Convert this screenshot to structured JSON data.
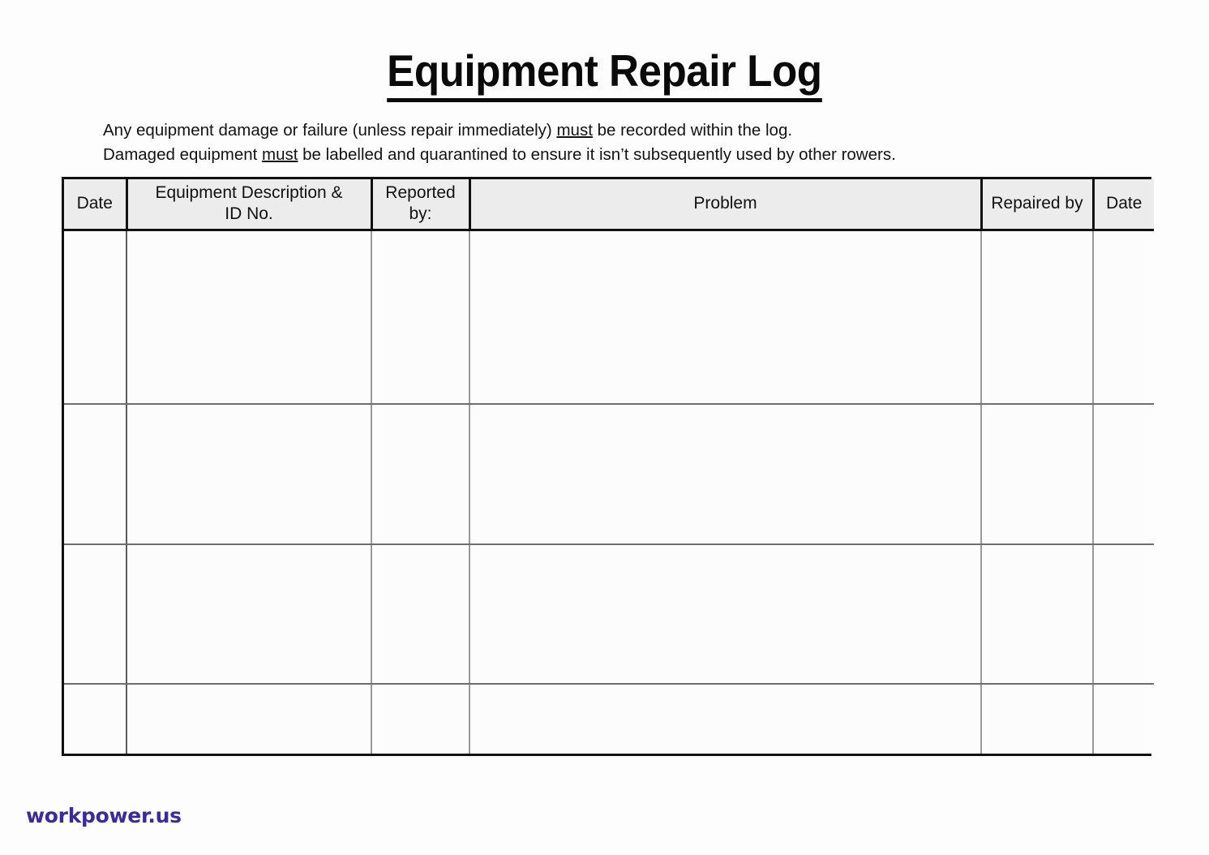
{
  "document": {
    "title": "Equipment Repair Log",
    "intro_lines": [
      {
        "segments": [
          {
            "text": "Any equipment damage or failure (unless repair immediately) ",
            "underline": false
          },
          {
            "text": "must",
            "underline": true
          },
          {
            "text": " be recorded within the log.",
            "underline": false
          }
        ]
      },
      {
        "segments": [
          {
            "text": "Damaged equipment ",
            "underline": false
          },
          {
            "text": "must",
            "underline": true
          },
          {
            "text": " be labelled and quarantined to ensure it isn’t subsequently used by other rowers.",
            "underline": false
          }
        ]
      }
    ],
    "intro_line_1_part_1": "Any equipment damage or failure (unless repair immediately) ",
    "intro_line_1_emphasis": "must",
    "intro_line_1_part_2": " be recorded within the log.",
    "intro_line_2_part_1": "Damaged equipment ",
    "intro_line_2_emphasis": "must",
    "intro_line_2_part_2": " be labelled and quarantined to ensure it isn’t subsequently used by other rowers."
  },
  "table": {
    "headers": [
      {
        "label": "Date",
        "key": "date_reported"
      },
      {
        "label": "Equipment Description & ID No.",
        "key": "equipment_description"
      },
      {
        "label": "Reported by:",
        "key": "reported_by"
      },
      {
        "label": "Problem",
        "key": "problem"
      },
      {
        "label": "Repaired by",
        "key": "repaired_by"
      },
      {
        "label": "Date",
        "key": "date_repaired"
      }
    ],
    "header_line_breaks": {
      "equipment_description": [
        "Equipment Description &",
        "ID No."
      ],
      "reported_by": [
        "Reported",
        "by:"
      ]
    },
    "rows": [
      {
        "date_reported": "",
        "equipment_description": "",
        "reported_by": "",
        "problem": "",
        "repaired_by": "",
        "date_repaired": ""
      },
      {
        "date_reported": "",
        "equipment_description": "",
        "reported_by": "",
        "problem": "",
        "repaired_by": "",
        "date_repaired": ""
      },
      {
        "date_reported": "",
        "equipment_description": "",
        "reported_by": "",
        "problem": "",
        "repaired_by": "",
        "date_repaired": ""
      },
      {
        "date_reported": "",
        "equipment_description": "",
        "reported_by": "",
        "problem": "",
        "repaired_by": "",
        "date_repaired": ""
      }
    ],
    "row_count": 4
  },
  "footer": {
    "watermark": "workpower.us"
  },
  "colors": {
    "page_background": "#fdfdfd",
    "text": "#111111",
    "header_fill": "#ececec",
    "border_outer": "#111111",
    "border_inner": "#6e6e6e",
    "watermark": "#3b2a9c"
  }
}
